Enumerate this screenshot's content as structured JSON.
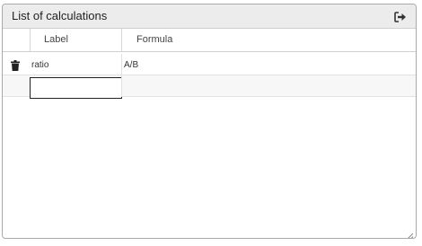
{
  "panel": {
    "title": "List of calculations",
    "export_icon": "sign-out-icon"
  },
  "table": {
    "columns": [
      {
        "key": "label",
        "header": "Label"
      },
      {
        "key": "formula",
        "header": "Formula"
      }
    ],
    "rows": [
      {
        "label": "ratio",
        "formula": "A/B",
        "delete_icon": "trash-icon"
      }
    ],
    "new_row": {
      "label_value": "",
      "formula_value": ""
    }
  }
}
